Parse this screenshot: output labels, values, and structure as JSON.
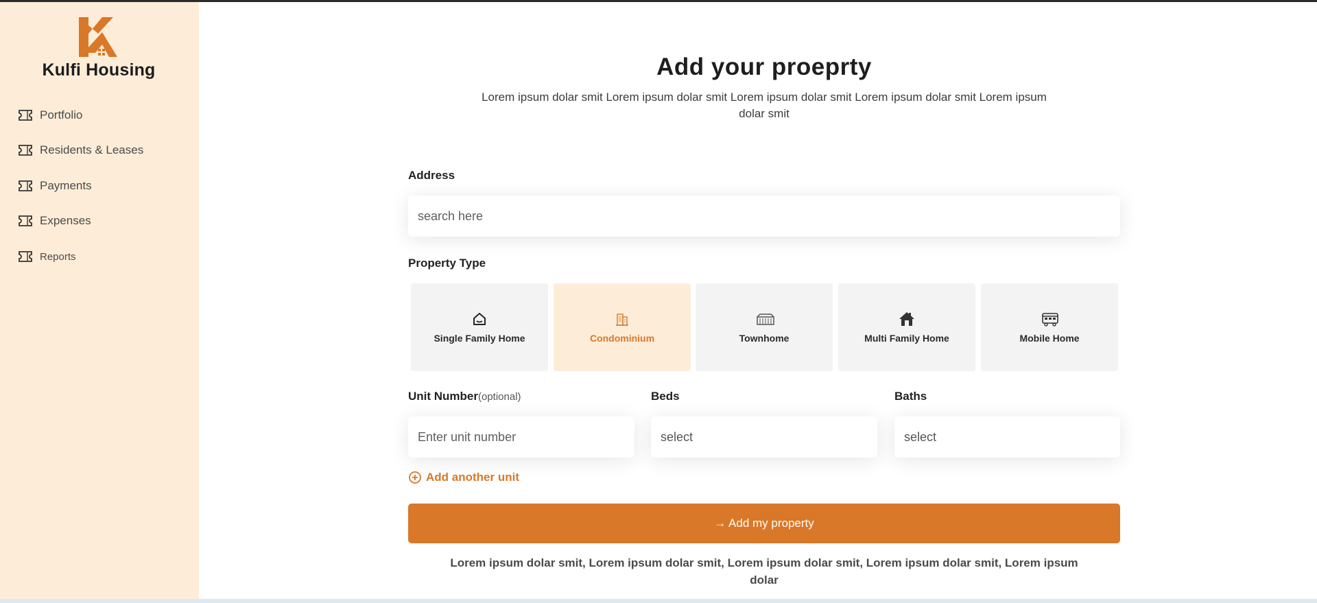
{
  "brand": {
    "name": "Kulfi Housing"
  },
  "sidebar": {
    "items": [
      {
        "label": "Portfolio",
        "icon": "ticket-icon"
      },
      {
        "label": "Residents & Leases",
        "icon": "ticket-icon"
      },
      {
        "label": "Payments",
        "icon": "ticket-icon"
      },
      {
        "label": "Expenses",
        "icon": "ticket-icon"
      },
      {
        "label": "Reports",
        "icon": "ticket-icon"
      }
    ]
  },
  "main": {
    "title": "Add your proeprty",
    "subtitle": "Lorem ipsum dolar smit Lorem ipsum dolar smit Lorem ipsum dolar smit Lorem ipsum dolar smit Lorem ipsum dolar smit",
    "address": {
      "label": "Address",
      "placeholder": "search here"
    },
    "property_type": {
      "label": "Property Type",
      "options": [
        {
          "label": "Single Family Home",
          "icon": "house-outline-icon",
          "selected": false
        },
        {
          "label": "Condominium",
          "icon": "building-icon",
          "selected": true
        },
        {
          "label": "Townhome",
          "icon": "townhome-icon",
          "selected": false
        },
        {
          "label": "Multi Family Home",
          "icon": "house-filled-icon",
          "selected": false
        },
        {
          "label": "Mobile Home",
          "icon": "mobile-home-icon",
          "selected": false
        }
      ]
    },
    "unit_number": {
      "label": "Unit Number",
      "optional": "(optional)",
      "placeholder": "Enter unit number"
    },
    "beds": {
      "label": "Beds",
      "placeholder": "select"
    },
    "baths": {
      "label": "Baths",
      "placeholder": "select"
    },
    "add_unit": "Add another unit",
    "submit": "→ Add my property",
    "footer_note": "Lorem ipsum dolar smit, Lorem ipsum dolar smit, Lorem ipsum dolar smit, Lorem ipsum dolar smit, Lorem ipsum dolar"
  },
  "colors": {
    "accent": "#d97828",
    "sidebar_bg": "#fdedd8",
    "selected_bg": "#fdedd8",
    "card_bg": "#f3f3f3"
  }
}
